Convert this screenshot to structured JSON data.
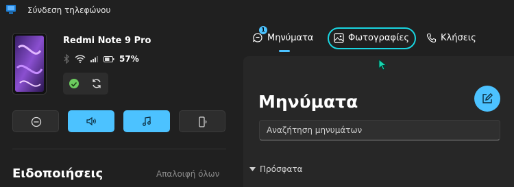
{
  "window": {
    "title": "Σύνδεση τηλεφώνου"
  },
  "device": {
    "name": "Redmi Note 9 Pro",
    "battery": "57%"
  },
  "quick_actions": [
    "do-not-disturb",
    "audio-output",
    "music",
    "phone-call-audio"
  ],
  "notifications": {
    "title": "Ειδοποιήσεις",
    "clear_all": "Απαλοιφή όλων"
  },
  "tabs": {
    "messages": {
      "label": "Μηνύματα",
      "badge": "1"
    },
    "photos": {
      "label": "Φωτογραφίες"
    },
    "calls": {
      "label": "Κλήσεις"
    }
  },
  "messages": {
    "title": "Μηνύματα",
    "search_placeholder": "Αναζήτηση μηνυμάτων",
    "recent_label": "Πρόσφατα"
  },
  "colors": {
    "accent": "#4cc2ff",
    "focus": "#19d6e2",
    "ok": "#6ccb5f"
  }
}
